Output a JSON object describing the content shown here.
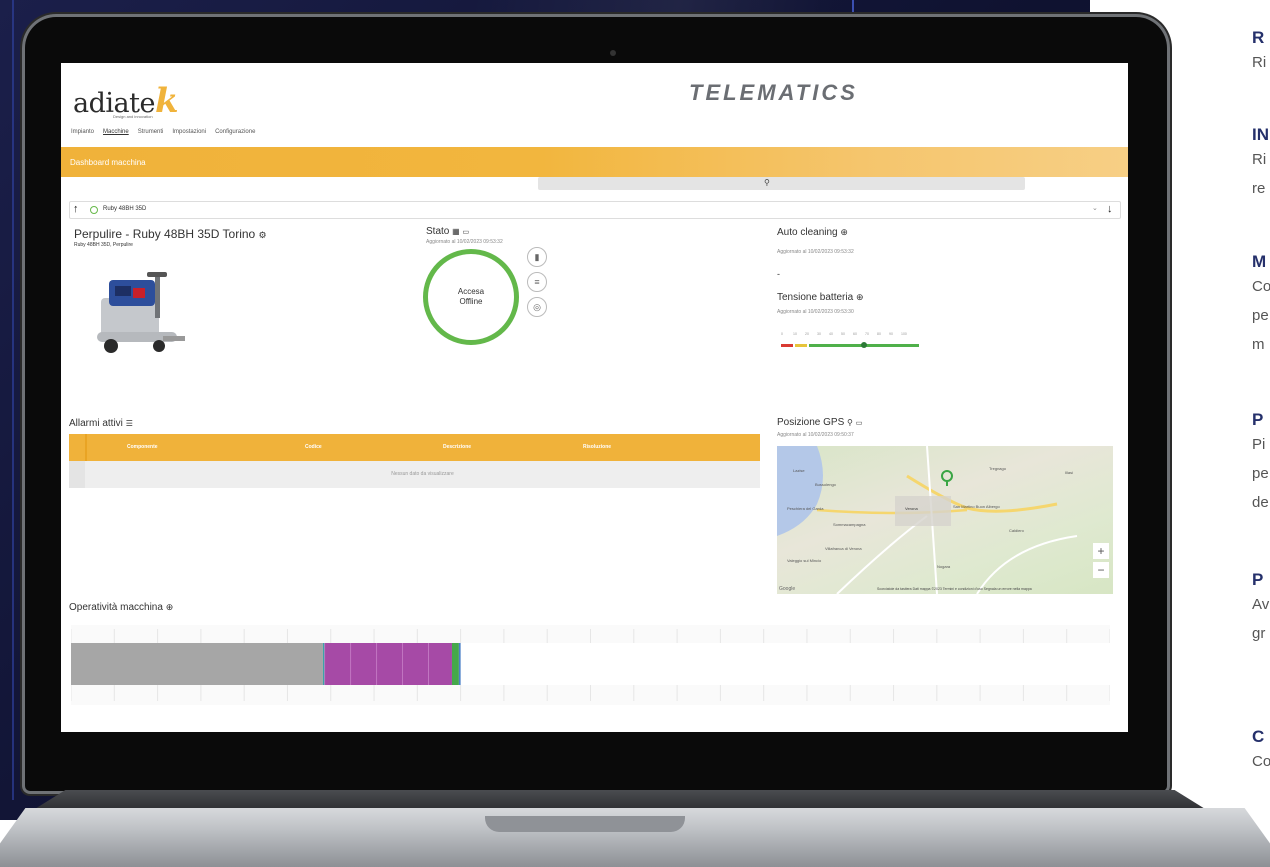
{
  "app": {
    "logo_text": "adiate",
    "logo_k": "k",
    "logo_tagline": "Design and innovation",
    "brand": "TELEMATICS",
    "nav": [
      "Impianto",
      "Macchine",
      "Strumenti",
      "Impostazioni",
      "Configurazione"
    ],
    "nav_active": "Macchine",
    "banner_title": "Dashboard macchina",
    "search_icon": "search-icon"
  },
  "selector": {
    "selected": "Ruby 48BH 35D",
    "up_icon": "arrow-up-icon",
    "down_icon": "arrow-down-icon"
  },
  "machine": {
    "title": "Perpulire - Ruby 48BH 35D Torino",
    "subtitle": "Ruby 48BH 35D, Perpulire"
  },
  "stato": {
    "title": "Stato",
    "updated": "Aggiornato al 10/02/2023 09:53:32",
    "state_line1": "Accesa",
    "state_line2": "Offline",
    "ring_color": "#63b84a"
  },
  "auto_cleaning": {
    "title": "Auto cleaning",
    "updated": "Aggiornato al 10/02/2023 09:53:32",
    "value": "-"
  },
  "battery": {
    "title": "Tensione batteria",
    "updated": "Aggiornato al 10/02/2023 09:53:30",
    "ticks": [
      "0",
      "10",
      "20",
      "30",
      "40",
      "50",
      "60",
      "70",
      "80",
      "90",
      "100"
    ],
    "level": 0.6
  },
  "alarms": {
    "title": "Allarmi attivi",
    "columns": [
      "Componente",
      "Codice",
      "Descrizione",
      "Risoluzione"
    ],
    "empty_text": "Nessun dato da visualizzare"
  },
  "gps": {
    "title": "Posizione GPS",
    "updated": "Aggiornato al 10/02/2023 09:50:37",
    "places": [
      "Lazise",
      "Bussolengo",
      "Verona",
      "San Martino Buon Albergo",
      "Villafranca di Verona",
      "Caldiero",
      "Peschiera del Garda",
      "Sommacampagna",
      "Nogara",
      "Valeggio sul Mincio",
      "Tregnago",
      "Illasi"
    ],
    "zoom_in": "+",
    "zoom_out": "−",
    "footer": "Scorciatoie da tastiera   Dati mappa ©2023   Termini e condizioni d'uso   Segnala un errore nella mappa",
    "google": "Google"
  },
  "operativity": {
    "title": "Operatività macchina",
    "ticks": [
      "00",
      "02",
      "04",
      "06",
      "08",
      "10",
      "12",
      "14",
      "16",
      "18",
      "20",
      "22",
      "24"
    ],
    "segments": [
      {
        "state": "grey",
        "color": "#a6a6a6",
        "from": 0.0,
        "to": 5.82
      },
      {
        "state": "teal",
        "color": "#3ca5a8",
        "from": 5.82,
        "to": 5.86
      },
      {
        "state": "purple",
        "color": "#a64aa6",
        "from": 5.86,
        "to": 8.8
      },
      {
        "state": "green",
        "color": "#45a84a",
        "from": 8.8,
        "to": 8.96
      },
      {
        "state": "blue",
        "color": "#4a7fc8",
        "from": 8.96,
        "to": 9.0
      }
    ]
  },
  "side_text": [
    {
      "h": "R",
      "t": [
        "Ri"
      ]
    },
    {
      "h": "IN",
      "t": [
        "Ri",
        "re"
      ]
    },
    {
      "h": "M",
      "t": [
        "Co",
        "pe",
        "m"
      ]
    },
    {
      "h": "P",
      "t": [
        "Pi",
        "pe",
        "de"
      ]
    },
    {
      "h": "P",
      "t": [
        "Av",
        "gr"
      ]
    },
    {
      "h": "C",
      "t": [
        "Co"
      ]
    }
  ]
}
